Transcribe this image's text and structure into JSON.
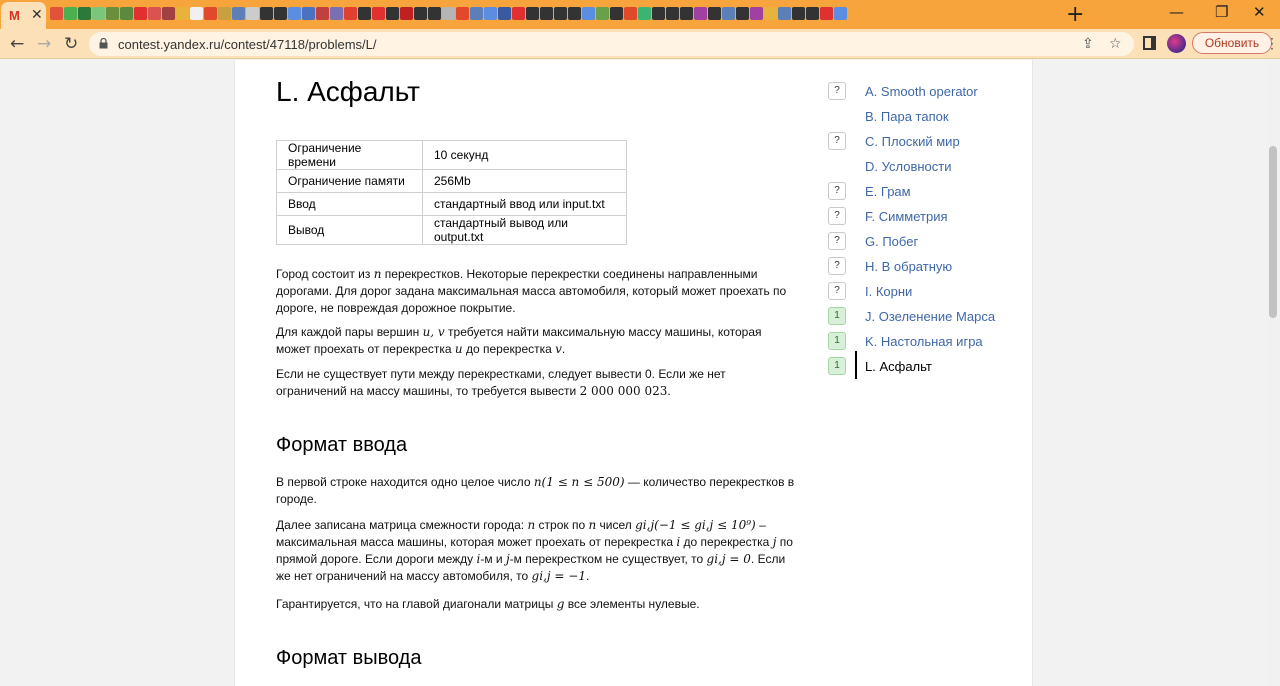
{
  "browser": {
    "url": "contest.yandex.ru/contest/47118/problems/L/",
    "update_label": "Обновить",
    "favicon_colors": [
      "#e0533a",
      "#4caf50",
      "#2c7a3a",
      "#7bc67b",
      "#6a8f3a",
      "#5b8a3e",
      "#e03030",
      "#d9534f",
      "#a04040",
      "#e8b33a",
      "#f0f0f0",
      "#e04a2a",
      "#c8a040",
      "#5d7fb8",
      "#ccc",
      "#333",
      "#333",
      "#5b8de0",
      "#4a72c0",
      "#c04040",
      "#7a6fb0",
      "#e04030",
      "#333",
      "#e03030",
      "#333",
      "#c02020",
      "#333",
      "#333",
      "#b5b5b5",
      "#e04a2a",
      "#5d7fb8",
      "#5b8de0",
      "#3a5aa0",
      "#e03030",
      "#333",
      "#333",
      "#333",
      "#333",
      "#5b8de0",
      "#6aa04a",
      "#333",
      "#e04a2a",
      "#3cb371",
      "#333",
      "#333",
      "#333",
      "#a040a0",
      "#333",
      "#5d7fb8",
      "#333",
      "#a040a0",
      "#e8b33a",
      "#5d7fb8",
      "#333",
      "#333",
      "#e03030",
      "#5b8de0"
    ]
  },
  "problem": {
    "title": "L. Асфальт",
    "limits": [
      {
        "key": "Ограничение времени",
        "value": "10 секунд"
      },
      {
        "key": "Ограничение памяти",
        "value": "256Mb"
      },
      {
        "key": "Ввод",
        "value": "стандартный ввод или input.txt"
      },
      {
        "key": "Вывод",
        "value": "стандартный вывод или output.txt"
      }
    ],
    "statement_p1_a": "Город состоит из ",
    "statement_p1_n": "n",
    "statement_p1_b": " перекрестков. Некоторые перекрестки соединены направленными дорогами. Для дорог задана максимальная масса автомобиля, который может проехать по дороге, не повреждая дорожное покрытие.",
    "statement_p2_a": "Для каждой пары вершин ",
    "statement_p2_uv": "u, v",
    "statement_p2_b": " требуется найти максимальную массу машины, которая может проехать от перекрестка ",
    "statement_p2_u": "u",
    "statement_p2_c": " до перекрестка ",
    "statement_p2_v": "v",
    "statement_p2_d": ".",
    "statement_p3_a": "Если не существует пути между перекрестками, следует вывести 0. Если же нет ограничений на массу машины, то требуется вывести ",
    "statement_p3_num": "2 000 000 023",
    "statement_p3_b": ".",
    "input_heading": "Формат ввода",
    "input_p1_a": "В первой строке находится одно целое число ",
    "input_p1_math": "n(1 ≤ n ≤ 500)",
    "input_p1_b": " — количество перекрестков в городе.",
    "input_p2_a": "Далее записана матрица смежности города: ",
    "input_p2_n1": "n",
    "input_p2_b": " строк по ",
    "input_p2_n2": "n",
    "input_p2_c": " чисел ",
    "input_p2_g": "gi,j",
    "input_p2_range": "(−1 ≤ gi,j ≤ 10⁹)",
    "input_p2_d": " – максимальная масса машины, которая может проехать от перекрестка ",
    "input_p2_i": "i",
    "input_p2_e": " до перекрестка ",
    "input_p2_j": "j",
    "input_p2_f": " по прямой дороге. Если дороги между ",
    "input_p2_i2": "i",
    "input_p2_g2": "-м и ",
    "input_p2_j2": "j",
    "input_p2_h": "-м перекрестком не существует, то ",
    "input_p2_zero": "gi,j = 0",
    "input_p2_k": ". Если же нет ограничений на массу автомобиля, то ",
    "input_p2_minus": "gi,j = −1",
    "input_p2_l": ".",
    "input_p3_a": "Гарантируется, что на главой диагонали матрицы ",
    "input_p3_g": "g",
    "input_p3_b": " все элементы нулевые.",
    "output_heading": "Формат вывода"
  },
  "problems_nav": [
    {
      "badge": "?",
      "label": "A. Smooth operator",
      "status": "pending"
    },
    {
      "badge": "",
      "label": "B. Пара тапок",
      "status": "none"
    },
    {
      "badge": "?",
      "label": "C. Плоский мир",
      "status": "pending"
    },
    {
      "badge": "",
      "label": "D. Условности",
      "status": "none"
    },
    {
      "badge": "?",
      "label": "E. Грам",
      "status": "pending"
    },
    {
      "badge": "?",
      "label": "F. Симметрия",
      "status": "pending"
    },
    {
      "badge": "?",
      "label": "G. Побег",
      "status": "pending"
    },
    {
      "badge": "?",
      "label": "H. В обратную",
      "status": "pending"
    },
    {
      "badge": "?",
      "label": "I. Корни",
      "status": "pending"
    },
    {
      "badge": "1",
      "label": "J. Озеленение Марса",
      "status": "ok"
    },
    {
      "badge": "1",
      "label": "K. Настольная игра",
      "status": "ok"
    },
    {
      "badge": "1",
      "label": "L. Асфальт",
      "status": "ok",
      "current": true
    }
  ]
}
